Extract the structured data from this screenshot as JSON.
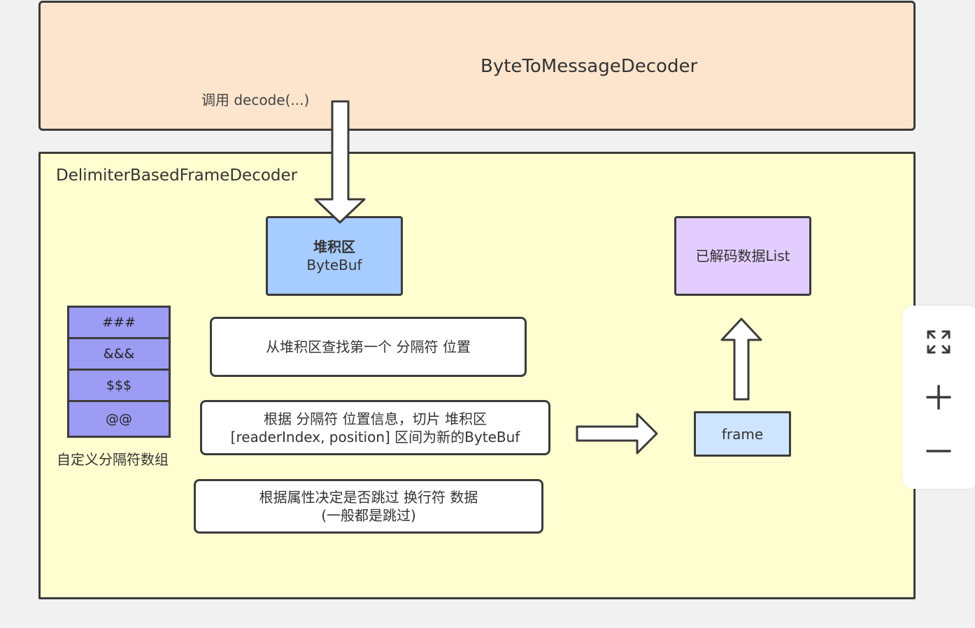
{
  "diagram": {
    "outer_top": {
      "title": "ByteToMessageDecoder",
      "call_label": "调用 decode(...)"
    },
    "outer_main": {
      "title": "DelimiterBasedFrameDecoder"
    },
    "bytebuf": {
      "line1": "堆积区",
      "line2": "ByteBuf"
    },
    "decoded_list": {
      "label": "已解码数据List"
    },
    "delimiters": {
      "items": [
        "###",
        "&&&",
        "$$$",
        "@@"
      ],
      "caption": "自定义分隔符数组"
    },
    "steps": [
      {
        "line1": "从堆积区查找第一个 分隔符 位置"
      },
      {
        "line1": "根据 分隔符 位置信息，切片 堆积区",
        "line2": "[readerIndex, position] 区间为新的ByteBuf"
      },
      {
        "line1": "根据属性决定是否跳过 换行符 数据",
        "line2": "(一般都是跳过)"
      }
    ],
    "frame": {
      "label": "frame"
    }
  },
  "zoom_controls": [
    "fullscreen-icon",
    "zoom-in-icon",
    "zoom-out-icon"
  ]
}
